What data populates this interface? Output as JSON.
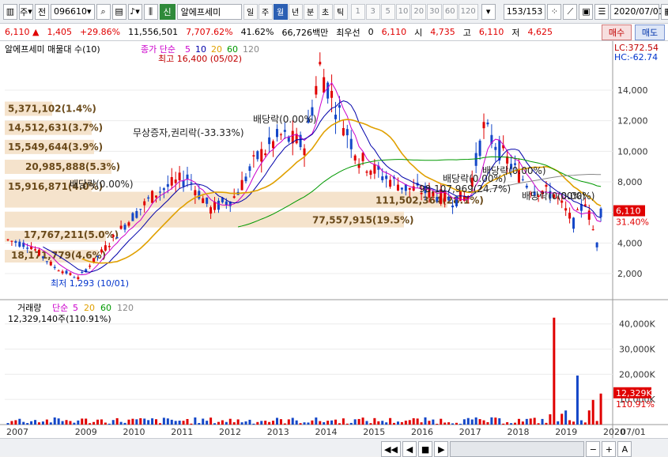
{
  "toolbar": {
    "market": "주",
    "tab_jeon": "전",
    "code": "096610",
    "tag": "신",
    "stock_name": "알에프세미",
    "periods": [
      "일",
      "주",
      "월",
      "년",
      "분",
      "초",
      "틱"
    ],
    "active_period": "월",
    "intervals": [
      "1",
      "3",
      "5",
      "10",
      "20",
      "30",
      "60",
      "120"
    ],
    "count": "153",
    "count_total": "/153",
    "date": "2020/07/01"
  },
  "quote": {
    "price": "6,110",
    "change": "1,405",
    "change_pct": "+29.86%",
    "volume": "11,556,501",
    "vol_ratio": "7,707.62%",
    "turnover": "41.62%",
    "amount": "66,726백만",
    "best_label": "최우선",
    "best_value": "0",
    "last": "6,110",
    "open_label": "시",
    "open": "4,735",
    "high_label": "고",
    "high": "6,110",
    "low_label": "저",
    "low": "4,625",
    "buy_label": "매수",
    "sell_label": "매도"
  },
  "price_panel": {
    "title": "알에프세미 매물대 수(10)",
    "ma_label": "종가 단순",
    "ma_periods": [
      "5",
      "10",
      "20",
      "60",
      "120"
    ],
    "max_note": "최고 16,400 (05/02)",
    "min_note": "최저 1,293 (10/01)",
    "lc": "LC:372.54",
    "hc": "HC:-62.74",
    "last_price_tag": "6,110",
    "last_pct_tag": "31.40%",
    "y_ticks": [
      "14,000",
      "12,000",
      "10,000",
      "8,000",
      "6,000",
      "4,000",
      "2,000"
    ],
    "volume_profile": [
      "5,371,102(1.4%)",
      "14,512,631(3.7%)",
      "15,549,644(3.9%)",
      "20,985,888(5.3%)",
      "15,916,871(4.0%)",
      "111,502,364(28.1%)",
      "77,557,915(19.5%)",
      "17,767,211(5.0%)",
      "18,171,779(4.6%)"
    ],
    "events": [
      "배당락(0.00%)",
      "무상증자,권리락(-33.33%)",
      "배당락(0.00%)",
      "배당락(0.00%)",
      "배당락(0.00%)",
      "배당락(0.00%)",
      "98,107,969(24.7%)",
      "(0.00%)"
    ]
  },
  "volume_panel": {
    "title": "거래량",
    "ma_label": "단순",
    "ma_periods": [
      "5",
      "20",
      "60",
      "120"
    ],
    "current": "12,329,140주(110.91%)",
    "y_ticks": [
      "40,000K",
      "30,000K",
      "20,000K",
      "10,000K"
    ],
    "last_tag": "12,329K",
    "last_pct": "110.91%"
  },
  "x_axis": {
    "years": [
      "2007",
      "2009",
      "2010",
      "2011",
      "2012",
      "2013",
      "2014",
      "2015",
      "2016",
      "2017",
      "2018",
      "2019",
      "2020"
    ],
    "right_label": "07/01"
  },
  "colors": {
    "up": "#e00000",
    "down": "#1447c8",
    "ma5": "#cc00cc",
    "ma10": "#0000aa",
    "ma20": "#e0a000",
    "ma60": "#009900",
    "ma120": "#888888",
    "profile": "#f5e3cc"
  }
}
